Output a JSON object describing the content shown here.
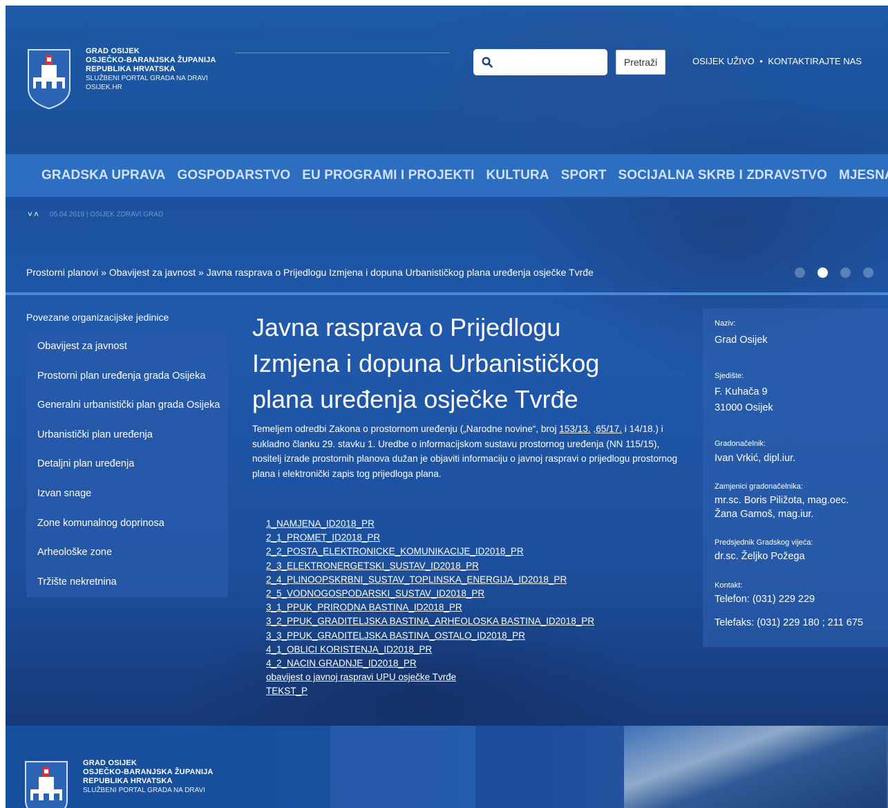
{
  "header": {
    "logo_lines": [
      "GRAD OSIJEK",
      "OSJEČKO-BARANJSKA ŽUPANIJA",
      "REPUBLIKA HRVATSKA"
    ],
    "logo_sub": "SLUŽBENI PORTAL GRADA NA DRAVI",
    "logo_site": "OSIJEK.HR",
    "search_placeholder": "",
    "search_button": "Pretraži",
    "top_links": [
      "OSIJEK UŽIVO",
      "KONTAKTIRAJTE NAS"
    ],
    "top_links_sep": "•"
  },
  "nav": {
    "items": [
      "GRADSKA UPRAVA",
      "GOSPODARSTVO",
      "EU PROGRAMI I PROJEKTI",
      "KULTURA",
      "SPORT",
      "SOCIJALNA SKRB I ZDRAVSTVO",
      "MJESNA SAMOUPRAVA"
    ]
  },
  "ticker": {
    "chevrons": "˅˄",
    "text": "05.04.2019 | OSIJEK ZDRAVI GRAD"
  },
  "breadcrumb": [
    "Prostorni planovi",
    "Obavijest za javnost",
    "Javna rasprava o Prijedlogu Izmjena i dopuna Urbanističkog plana uređenja osječke Tvrđe"
  ],
  "breadcrumb_sep": "»",
  "sidebar": {
    "title": "Povezane organizacijske jedinice",
    "items": [
      "Obavijest za javnost",
      "Prostorni plan uređenja grada Osijeka",
      "Generalni urbanistički plan grada Osijeka",
      "Urbanistički plan uređenja",
      "Detaljni plan uređenja",
      "Izvan snage",
      "Zone komunalnog doprinosa",
      "Arheološke zone",
      "Tržište nekretnina"
    ]
  },
  "main": {
    "title": "Javna rasprava o Prijedlogu Izmjena i dopuna Urbanističkog plana uređenja osječke Tvrđe",
    "intro_a": "Temeljem odredbi Zakona o prostornom uređenju („Narodne novine“, broj ",
    "intro_link1": "153/13.",
    "intro_b": " ,",
    "intro_link2": "65/17.",
    "intro_c": " i 14/18.) i sukladno članku 29. stavku 1. Uredbe o informacijskom sustavu prostornog uređenja (NN 115/15), nositelj izrade prostornih planova dužan je objaviti informaciju o javnoj raspravi o prijedlogu prostornog plana i elektronički zapis tog prijedloga plana.",
    "documents": [
      "1_NAMJENA_ID2018_PR",
      "2_1_PROMET_ID2018_PR",
      "2_2_POSTA_ELEKTRONICKE_KOMUNIKACIJE_ID2018_PR",
      "2_3_ELEKTRONERGETSKI_SUSTAV_ID2018_PR",
      "2_4_PLINOOPSKRBNI_SUSTAV_TOPLINSKA_ENERGIJA_ID2018_PR",
      "2_5_VODNOGOSPODARSKI_SUSTAV_ID2018_PR",
      "3_1_PPUK_PRIRODNA BASTINA_ID2018_PR",
      "3_2_PPUK_GRADITELJSKA BASTINA_ARHEOLOSKA BASTINA_ID2018_PR",
      "3_3_PPUK_GRADITELJSKA BASTINA_OSTALO_ID2018_PR",
      "4_1_OBLICI KORISTENJA_ID2018_PR",
      "4_2_NACIN GRADNJE_ID2018_PR",
      "obavijest o javnoj raspravi UPU osječke Tvrđe",
      "TEKST_P"
    ]
  },
  "info": {
    "naziv_label": "Naziv:",
    "naziv": "Grad Osijek",
    "sjediste_label": "Sjedište:",
    "sjediste_1": "F. Kuhača 9",
    "sjediste_2": "31000 Osijek",
    "gradonacelnik_label": "Gradonačelnik:",
    "gradonacelnik": "Ivan Vrkić, dipl.iur.",
    "zamjenici_label": "Zamjenici gradonačelnika:",
    "zamjenik_1": "mr.sc. Boris Piližota, mag.oec.",
    "zamjenik_2": "Žana Gamoš, mag.iur.",
    "predsjednik_label": "Predsjednik Gradskog vijeća:",
    "predsjednik": "dr.sc. Željko Požega",
    "kontakt_label": "Kontakt:",
    "telefon": "Telefon: (031) 229 229",
    "telefaks": "Telefaks: (031) 229 180 ; 211 675"
  },
  "footer": {
    "logo_lines": [
      "GRAD OSIJEK",
      "OSJEČKO-BARANJSKA ŽUPANIJA",
      "REPUBLIKA HRVATSKA"
    ],
    "logo_sub": "SLUŽBENI PORTAL GRADA NA DRAVI"
  },
  "colors": {
    "nav_bar": "#2d6ec0",
    "nav_text": "#cfe2ff",
    "accent_rule": "#4a89d6",
    "panel": "#285aaa"
  },
  "icons": [
    "search-icon",
    "home-icon",
    "coat-of-arms-logo"
  ]
}
